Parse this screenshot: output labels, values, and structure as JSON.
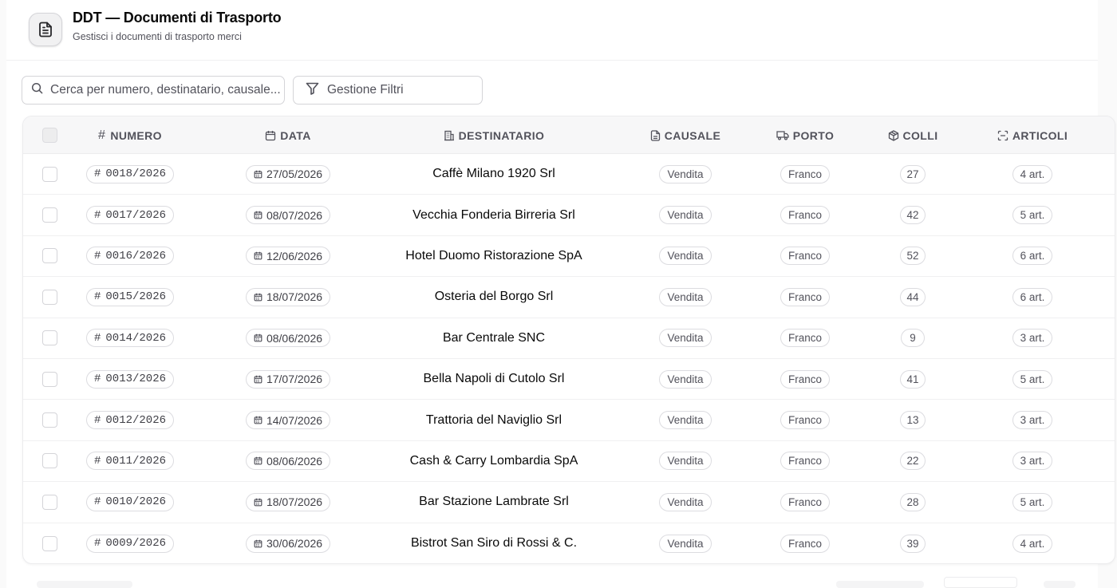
{
  "header": {
    "title": "DDT — Documenti di Trasporto",
    "subtitle": "Gestisci i documenti di trasporto merci",
    "icon": "document-icon"
  },
  "toolbar": {
    "search_placeholder": "Cerca per numero, destinatario, causale...",
    "filter_label": "Gestione Filtri"
  },
  "table": {
    "columns": {
      "numero": "NUMERO",
      "data": "DATA",
      "destinatario": "DESTINATARIO",
      "causale": "CAUSALE",
      "porto": "PORTO",
      "colli": "COLLI",
      "articoli": "ARTICOLI"
    },
    "rows": [
      {
        "numero": "0018/2026",
        "data": "27/05/2026",
        "destinatario": "Caffè Milano 1920 Srl",
        "causale": "Vendita",
        "porto": "Franco",
        "colli": "27",
        "articoli": "4 art."
      },
      {
        "numero": "0017/2026",
        "data": "08/07/2026",
        "destinatario": "Vecchia Fonderia Birreria Srl",
        "causale": "Vendita",
        "porto": "Franco",
        "colli": "42",
        "articoli": "5 art."
      },
      {
        "numero": "0016/2026",
        "data": "12/06/2026",
        "destinatario": "Hotel Duomo Ristorazione SpA",
        "causale": "Vendita",
        "porto": "Franco",
        "colli": "52",
        "articoli": "6 art."
      },
      {
        "numero": "0015/2026",
        "data": "18/07/2026",
        "destinatario": "Osteria del Borgo Srl",
        "causale": "Vendita",
        "porto": "Franco",
        "colli": "44",
        "articoli": "6 art."
      },
      {
        "numero": "0014/2026",
        "data": "08/06/2026",
        "destinatario": "Bar Centrale SNC",
        "causale": "Vendita",
        "porto": "Franco",
        "colli": "9",
        "articoli": "3 art."
      },
      {
        "numero": "0013/2026",
        "data": "17/07/2026",
        "destinatario": "Bella Napoli di Cutolo Srl",
        "causale": "Vendita",
        "porto": "Franco",
        "colli": "41",
        "articoli": "5 art."
      },
      {
        "numero": "0012/2026",
        "data": "14/07/2026",
        "destinatario": "Trattoria del Naviglio Srl",
        "causale": "Vendita",
        "porto": "Franco",
        "colli": "13",
        "articoli": "3 art."
      },
      {
        "numero": "0011/2026",
        "data": "08/06/2026",
        "destinatario": "Cash & Carry Lombardia SpA",
        "causale": "Vendita",
        "porto": "Franco",
        "colli": "22",
        "articoli": "3 art."
      },
      {
        "numero": "0010/2026",
        "data": "18/07/2026",
        "destinatario": "Bar Stazione Lambrate Srl",
        "causale": "Vendita",
        "porto": "Franco",
        "colli": "28",
        "articoli": "5 art."
      },
      {
        "numero": "0009/2026",
        "data": "30/06/2026",
        "destinatario": "Bistrot San Siro di Rossi & C.",
        "causale": "Vendita",
        "porto": "Franco",
        "colli": "39",
        "articoli": "4 art."
      }
    ]
  },
  "colors": {
    "border": "#d4d4d8",
    "header_bg": "#f7f7f8",
    "text": "#18181b",
    "muted": "#52525b"
  }
}
